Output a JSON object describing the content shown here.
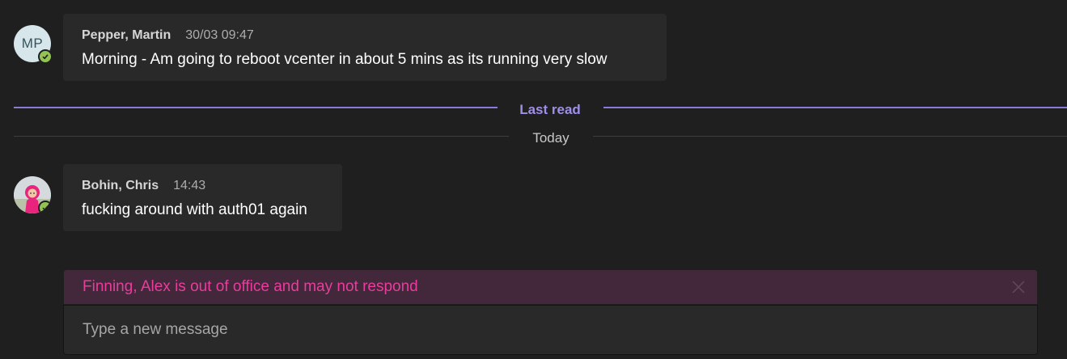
{
  "messages": [
    {
      "author": "Pepper, Martin",
      "timestamp": "30/03 09:47",
      "text": "Morning - Am going to reboot vcenter in about 5 mins as its running very slow",
      "avatar_initials": "MP",
      "presence": "available"
    },
    {
      "author": "Bohin, Chris",
      "timestamp": "14:43",
      "text": "fucking around with auth01 again",
      "avatar_initials": "",
      "presence": "available"
    }
  ],
  "dividers": {
    "last_read": "Last read",
    "today": "Today"
  },
  "oof_banner": {
    "text": "Finning, Alex is out of office and may not respond",
    "close_icon": "close-icon"
  },
  "compose": {
    "placeholder": "Type a new message",
    "value": ""
  },
  "colors": {
    "background": "#1f1f1f",
    "bubble": "#292929",
    "last_read_accent": "#8b7bd8",
    "oof_banner_bg": "#43283c",
    "oof_text": "#e93c9c",
    "presence_available": "#92c353"
  }
}
